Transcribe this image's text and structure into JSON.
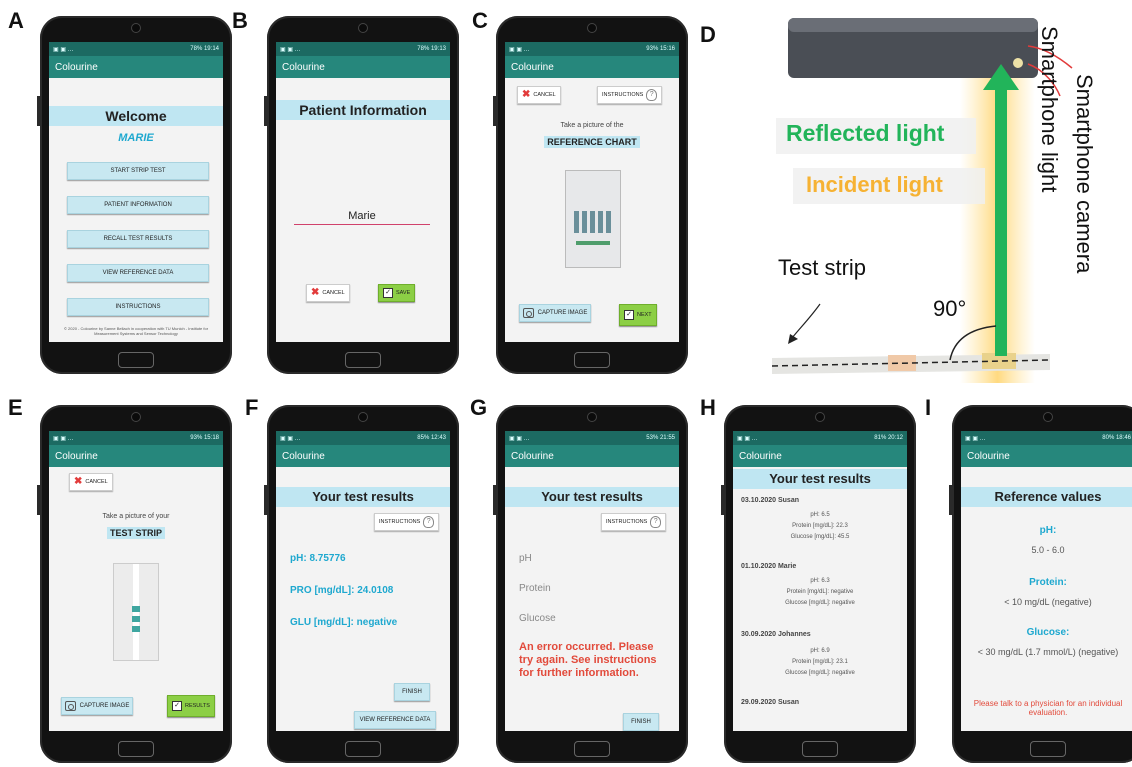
{
  "panel_labels": [
    "A",
    "B",
    "C",
    "D",
    "E",
    "F",
    "G",
    "H",
    "I"
  ],
  "app": {
    "title": "Colourine"
  },
  "status_bars": {
    "A": "78% 19:14",
    "B": "78% 19:13",
    "C": "93% 15:16",
    "E": "93% 15:18",
    "F": "85% 12:43",
    "G": "53% 21:55",
    "H": "81% 20:12",
    "I": "80% 18:46"
  },
  "screen_a": {
    "title": "Welcome",
    "user": "MARIE",
    "buttons": [
      "START STRIP TEST",
      "PATIENT INFORMATION",
      "RECALL TEST RESULTS",
      "VIEW REFERENCE DATA",
      "INSTRUCTIONS"
    ],
    "footer": "© 2020 - Colourine by Sanne Bellach in cooperation with TU Munich - Institute for Measurement Systems and Sensor Technology"
  },
  "screen_b": {
    "title": "Patient Information",
    "name_value": "Marie",
    "cancel": "CANCEL",
    "save": "SAVE"
  },
  "screen_c": {
    "cancel": "CANCEL",
    "instructions": "INSTRUCTIONS",
    "prompt": "Take a picture of the",
    "subject": "REFERENCE CHART",
    "capture": "CAPTURE IMAGE",
    "next": "NEXT"
  },
  "diagram_d": {
    "reflected": "Reflected light",
    "incident": "Incident light",
    "strip": "Test strip",
    "angle": "90°",
    "camera": "Smartphone camera",
    "light": "Smartphone light"
  },
  "screen_e": {
    "cancel": "CANCEL",
    "prompt": "Take a picture of your",
    "subject": "TEST STRIP",
    "capture": "CAPTURE IMAGE",
    "results": "RESULTS"
  },
  "screen_f": {
    "title": "Your test results",
    "instructions": "INSTRUCTIONS",
    "ph": "pH: 8.75776",
    "pro": "PRO [mg/dL]: 24.0108",
    "glu": "GLU [mg/dL]: negative",
    "finish": "FINISH",
    "view_ref": "VIEW REFERENCE DATA"
  },
  "screen_g": {
    "title": "Your test results",
    "instructions": "INSTRUCTIONS",
    "ph": "pH",
    "protein": "Protein",
    "glucose": "Glucose",
    "error": "An error occurred. Please try again. See instructions for further information.",
    "finish": "FINISH"
  },
  "screen_h": {
    "title": "Your test results",
    "entries": [
      {
        "date": "03.10.2020 Susan",
        "ph": "pH: 6.5",
        "protein": "Protein [mg/dL]: 22.3",
        "glucose": "Glucose [mg/dL]: 45.5"
      },
      {
        "date": "01.10.2020 Marie",
        "ph": "pH: 6.3",
        "protein": "Protein [mg/dL]: negative",
        "glucose": "Glucose [mg/dL]: negative"
      },
      {
        "date": "30.09.2020 Johannes",
        "ph": "pH: 6.9",
        "protein": "Protein [mg/dL]: 23.1",
        "glucose": "Glucose [mg/dL]: negative"
      },
      {
        "date": "29.09.2020 Susan"
      }
    ]
  },
  "screen_i": {
    "title": "Reference values",
    "ph_label": "pH:",
    "ph_value": "5.0 - 6.0",
    "protein_label": "Protein:",
    "protein_value": "< 10 mg/dL (negative)",
    "glucose_label": "Glucose:",
    "glucose_value": "< 30 mg/dL (1.7 mmol/L) (negative)",
    "note": "Please talk to a physician for an individual evaluation."
  },
  "colors": {
    "appbar": "#26877c",
    "title_bg": "#bfe6f2",
    "accent": "#1ea8cf",
    "error": "#e24a3b",
    "reflected": "#22b45a",
    "incident": "#f6b233"
  }
}
